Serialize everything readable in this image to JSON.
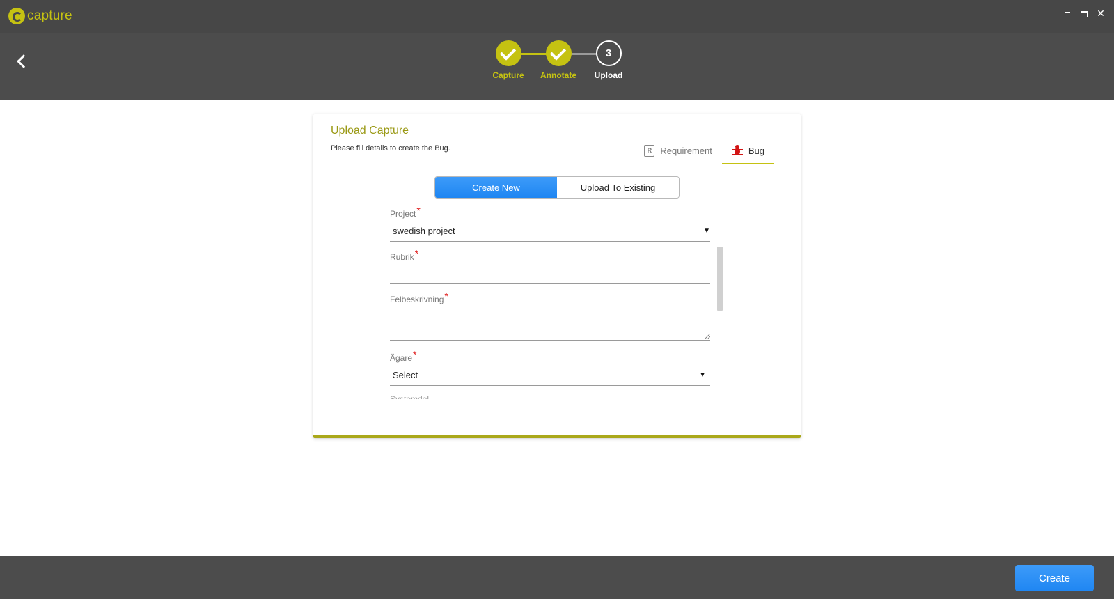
{
  "app": {
    "name": "capture",
    "window_controls": {
      "minimize_icon": "minimize-icon",
      "maximize_icon": "maximize-icon",
      "close_glyph": "✕"
    }
  },
  "header": {
    "back_icon": "chevron-left-icon",
    "steps": [
      {
        "label": "Capture",
        "state": "complete"
      },
      {
        "label": "Annotate",
        "state": "complete"
      },
      {
        "label": "Upload",
        "state": "current",
        "number": "3"
      }
    ]
  },
  "card": {
    "title": "Upload Capture",
    "subtitle": "Please fill details to create the Bug.",
    "type_tabs": [
      {
        "label": "Requirement",
        "icon": "requirement-icon",
        "active": false
      },
      {
        "label": "Bug",
        "icon": "bug-icon",
        "active": true
      }
    ],
    "mode_tabs": [
      {
        "label": "Create New",
        "active": true
      },
      {
        "label": "Upload To Existing",
        "active": false
      }
    ],
    "form": {
      "project": {
        "label": "Project",
        "required_mark": "*",
        "value": "swedish project"
      },
      "rubrik": {
        "label": "Rubrik",
        "required_mark": "*",
        "value": ""
      },
      "felbeskrivning": {
        "label": "Felbeskrivning",
        "required_mark": "*",
        "value": ""
      },
      "agare": {
        "label": "Ägare",
        "required_mark": "*",
        "value": "Select"
      },
      "next_field_label": "Systemdel"
    }
  },
  "footer": {
    "create_label": "Create"
  },
  "colors": {
    "accent": "#c5c212",
    "primary_button": "#2b8ff5",
    "required": "#e01e1e",
    "header_bg": "#4c4c4c",
    "bug_red": "#d21414"
  }
}
